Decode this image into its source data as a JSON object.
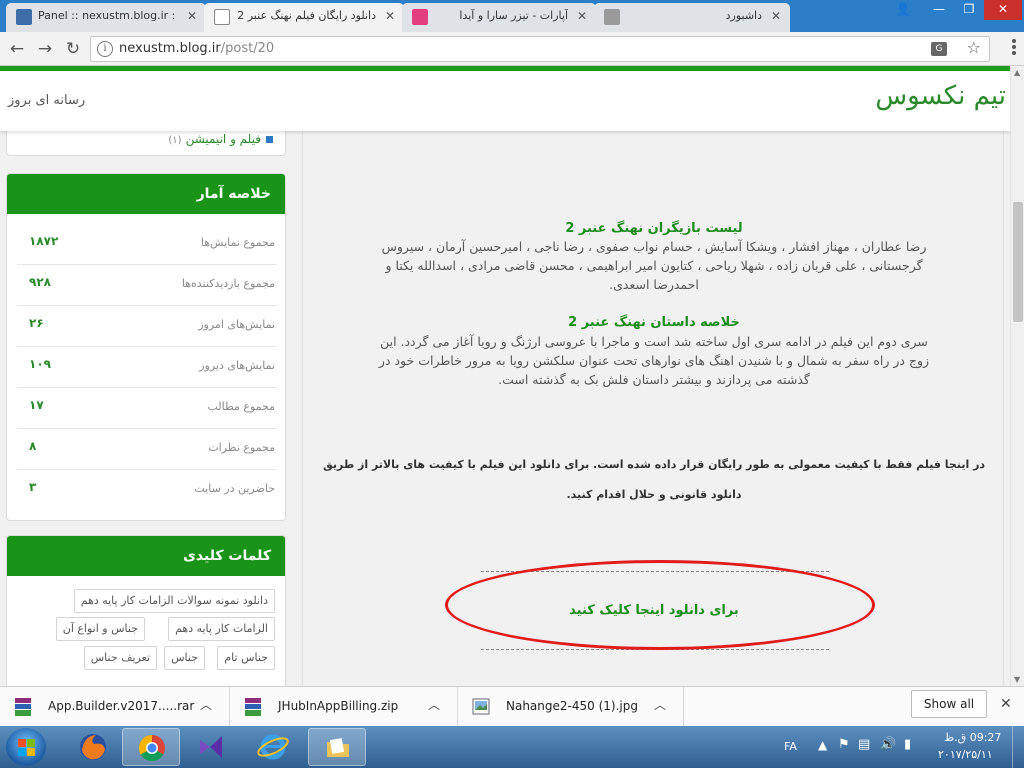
{
  "browser": {
    "tabs": [
      {
        "title": "Panel :: nexustm.blog.ir :",
        "icon": "blog-panel-icon",
        "active": false
      },
      {
        "title": "دانلود رایگان فیلم نهنگ عنبر 2",
        "icon": "page-icon",
        "active": true
      },
      {
        "title": "آپارات - تیزر سارا و آیدا",
        "icon": "aparat-icon",
        "active": false
      },
      {
        "title": "داشبورد",
        "icon": "dashboard-icon",
        "active": false
      }
    ],
    "url_host": "nexustm.blog.ir",
    "url_path": "/post/20"
  },
  "site": {
    "title": "تیم نکسوس",
    "tagline": "رسانه ای بروز"
  },
  "sidebar": {
    "category": {
      "label": "فیلم و انیمیشن",
      "count": "(۱)"
    },
    "stats": {
      "heading": "خلاصه آمار",
      "rows": [
        {
          "label": "مجموع نمایش‌ها",
          "value": "۱۸۷۲"
        },
        {
          "label": "مجموع بازدیدکننده‌ها",
          "value": "۹۲۸"
        },
        {
          "label": "نمایش‌های امروز",
          "value": "۲۶"
        },
        {
          "label": "نمایش‌های دیروز",
          "value": "۱۰۹"
        },
        {
          "label": "مجموع مطالب",
          "value": "۱۷"
        },
        {
          "label": "مجموع نظرات",
          "value": "۸"
        },
        {
          "label": "حاضرین در سایت",
          "value": "۳"
        }
      ]
    },
    "keywords": {
      "heading": "کلمات کلیدی",
      "tags": [
        "دانلود نمونه سوالات الزامات کار پایه دهم",
        "الزامات کار پایه دهم",
        "جناس و انواع آن",
        "جناس تام",
        "جناس",
        "تعریف جناس"
      ]
    }
  },
  "post": {
    "cast_title": "لیست بازیگران نهنگ عنبر 2",
    "cast_lines": [
      "رضا عطاران ، مهناز افشار ، ویشکا آسایش ، حسام نواب صفوی ، رضا ناجی ، امیرحسین آرمان ، سیروس",
      "گرجستانی ، علی قربان زاده ، شهلا ریاحی ، کتایون امیر ابراهیمی ، محسن قاضی مرادی ، اسدالله یکتا و",
      "احمدرضا اسعدی."
    ],
    "summary_title": "خلاصه داستان نهنگ عنبر 2",
    "summary_lines": [
      "سری دوم این فیلم در ادامه سری اول ساخته شد است و ماجرا با عروسی ارژنگ و رویا آغاز می گردد. این",
      "زوج در راه سفر به شمال و با شنیدن اهنگ های نوارهای تحت عنوان سلکشن رویا به مرور خاطرات خود در",
      "گذشته می پردازند و بیشتر داستان فلش بک به گذشته است."
    ],
    "notice_lines": [
      "در اینجا فیلم فقط با کیفیت معمولی به طور رایگان قرار داده شده است. برای دانلود این فیلم با کیفیت های بالاتر از طریق",
      "دانلود قانونی و حلال اقدام کنید."
    ],
    "download_link": "برای دانلود اینجا کلیک کنید"
  },
  "downloads": {
    "items": [
      {
        "name": "App.Builder.v2017.....rar",
        "icon": "rar-archive-icon"
      },
      {
        "name": "JHubInAppBilling.zip",
        "icon": "zip-archive-icon"
      },
      {
        "name": "Nahange2-450 (1).jpg",
        "icon": "image-file-icon"
      }
    ],
    "show_all": "Show all"
  },
  "taskbar": {
    "lang": "FA",
    "time": "09:27 ق.ظ",
    "date": "۲۰۱۷/۲۵/۱۱"
  }
}
